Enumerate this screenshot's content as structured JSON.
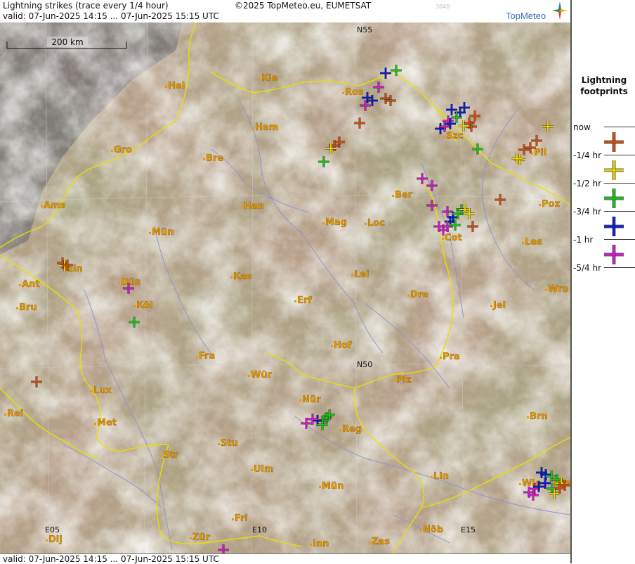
{
  "header": {
    "title": "Lightning strikes (trace every 1/4 hour)",
    "valid_line": "valid:  07-Jun-2025 14:15 ... 07-Jun-2025 15:15 UTC",
    "copyright": "©2025 TopMeteo.eu, EUMETSAT",
    "code": "3040",
    "brand": "TopMeteo"
  },
  "footer": {
    "valid_line": "valid:  07-Jun-2025 14:15 ... 07-Jun-2025 15:15 UTC"
  },
  "map": {
    "scale_label": "200 km",
    "grid_labels": [
      "N55",
      "N50",
      "E05",
      "E10",
      "E15"
    ],
    "cities": [
      "Hel",
      "Kie",
      "Ros",
      "Szc",
      "Ham",
      "Gro",
      "Bre",
      "Pil",
      "Ber",
      "Ams",
      "Han",
      "Poz",
      "Mün",
      "Mag",
      "Loc",
      "Cot",
      "Les",
      "Ein",
      "Kas",
      "Lei",
      "Ant",
      "Düs",
      "Wro",
      "Bru",
      "Köl",
      "Erf",
      "Dre",
      "Jel",
      "Hof",
      "Fra",
      "Pra",
      "Lux",
      "Wür",
      "Plz",
      "Rei",
      "Met",
      "Nür",
      "Reg",
      "Brn",
      "Stu",
      "Str",
      "Ulm",
      "Lin",
      "Wie",
      "Bra",
      "Mün",
      "Fri",
      "Zür",
      "Nöb",
      "Dij",
      "Inn",
      "Zas"
    ]
  },
  "legend": {
    "title_line1": "Lightning",
    "title_line2": "footprints",
    "items": [
      {
        "label": "now",
        "color": "#d24a10"
      },
      {
        "label": "-1/4 hr",
        "color": "#e4d000"
      },
      {
        "label": "-1/2 hr",
        "color": "#18c018"
      },
      {
        "label": "-3/4 hr",
        "color": "#0a1ed0"
      },
      {
        "label": "-1 hr",
        "color": "#d018c8"
      },
      {
        "label": "-5/4 hr",
        "color": null
      }
    ]
  },
  "colors": {
    "border": "#e8e000",
    "river": "#8a90d8",
    "city_label": "#e89a00",
    "grid": "#c8c8c8"
  }
}
